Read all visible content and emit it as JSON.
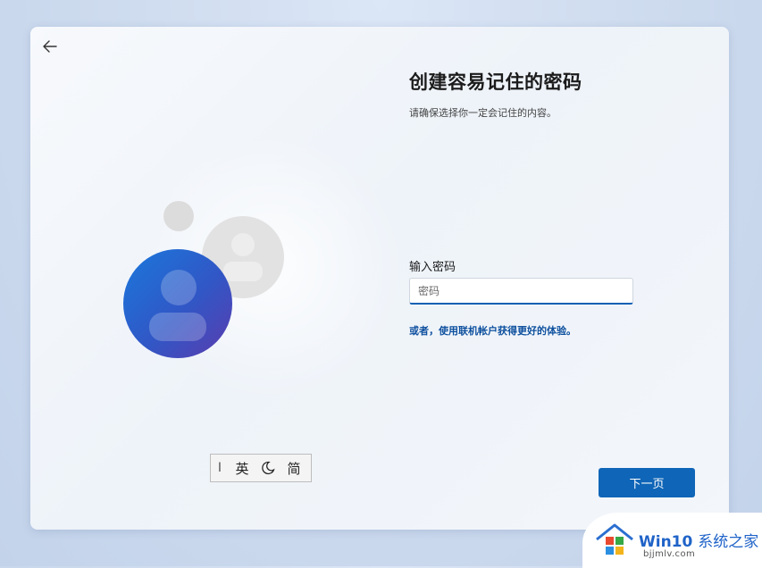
{
  "page": {
    "title": "创建容易记住的密码",
    "subtitle": "请确保选择你一定会记住的内容。"
  },
  "nav": {
    "back_icon": "arrow-left-icon"
  },
  "form": {
    "label": "输入密码",
    "placeholder": "密码",
    "value": ""
  },
  "alt_link": "或者，使用联机帐户获得更好的体验。",
  "buttons": {
    "next": "下一页"
  },
  "ime": {
    "cursor": "I",
    "lang": "英",
    "mode_icon": "moon-icon",
    "charset": "简"
  },
  "watermark": {
    "brand": "Win10",
    "brand_zh": "系统之家",
    "url": "bjjmlv.com"
  },
  "colors": {
    "accent": "#0f65b7",
    "link": "#0d4f9e",
    "avatar_gradient": [
      "#1d6fd6",
      "#3b53c0",
      "#5a3fb0"
    ]
  }
}
